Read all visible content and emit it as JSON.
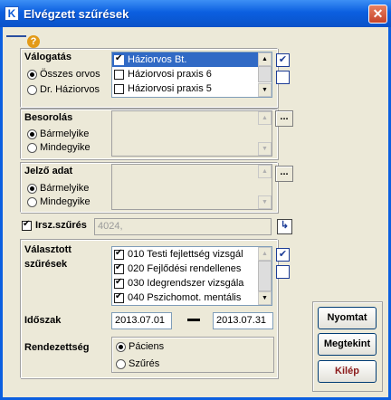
{
  "window": {
    "title": "Elvégzett szűrések",
    "app_icon_letter": "K",
    "close_glyph": "✕"
  },
  "help": {
    "glyph": "?"
  },
  "valogatas": {
    "label": "Válogatás",
    "options": [
      {
        "label": "Összes orvos",
        "selected": true
      },
      {
        "label": "Dr. Háziorvos",
        "selected": false
      }
    ],
    "items": [
      {
        "label": "Háziorvos Bt.",
        "checked": true,
        "selected": true
      },
      {
        "label": "Háziorvosi praxis 6",
        "checked": false,
        "selected": false
      },
      {
        "label": "Háziorvosi praxis 5",
        "checked": false,
        "selected": false
      }
    ]
  },
  "besorolas": {
    "label": "Besorolás",
    "options": [
      {
        "label": "Bármelyike",
        "selected": true
      },
      {
        "label": "Mindegyike",
        "selected": false
      }
    ],
    "dots_label": "..."
  },
  "jelzo": {
    "label": "Jelző adat",
    "options": [
      {
        "label": "Bármelyike",
        "selected": true
      },
      {
        "label": "Mindegyike",
        "selected": false
      }
    ],
    "dots_label": "..."
  },
  "irsz": {
    "label": "Irsz.szűrés",
    "checked": true,
    "value": "4024,"
  },
  "valasztott": {
    "label_line1": "Választott",
    "label_line2": "szűrések",
    "items": [
      {
        "label": "010 Testi fejlettség vizsgál",
        "checked": true
      },
      {
        "label": "020 Fejlődési rendellenes",
        "checked": true
      },
      {
        "label": "030 Idegrendszer vizsgála",
        "checked": true
      },
      {
        "label": "040 Pszichomot. mentális",
        "checked": true
      }
    ]
  },
  "idoszak": {
    "label": "Időszak",
    "from": "2013.07.01",
    "to": "2013.07.31"
  },
  "rendezettseg": {
    "label": "Rendezettség",
    "options": [
      {
        "label": "Páciens",
        "selected": true
      },
      {
        "label": "Szűrés",
        "selected": false
      }
    ]
  },
  "buttons": {
    "print": "Nyomtat",
    "view": "Megtekint",
    "exit": "Kilép",
    "exit_color": "#8b1a1a"
  },
  "icons": {
    "scroll_up": "▲",
    "scroll_down": "▼",
    "check_all": "✔",
    "irsz_icon": "↳"
  }
}
